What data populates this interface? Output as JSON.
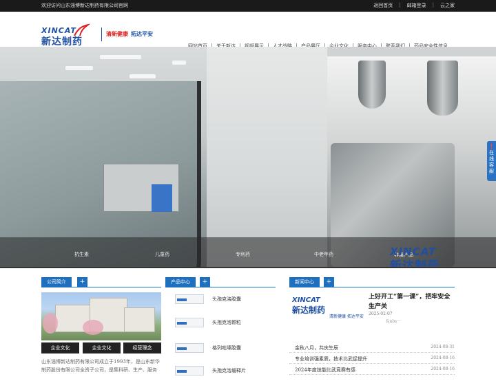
{
  "topbar": {
    "welcome": "欢迎访问山东淄博新达制药有限公司官网",
    "links": [
      "返回首页",
      "邮箱登录",
      "云之家"
    ]
  },
  "logo": {
    "en": "XINCAT",
    "cn": "新达制药"
  },
  "slogan": {
    "part1": "清新健康",
    "part2": "拓达平安"
  },
  "nav": [
    "网站首页",
    "关于新达",
    "视频展示",
    "人才战略",
    "产品展厅",
    "企业文化",
    "服务中心",
    "联系我们",
    "药品安全性信息"
  ],
  "hero": {
    "captions": [
      "抗生素",
      "儿童药",
      "专利药",
      "中老年药",
      "非甾产品"
    ],
    "watermark_en": "XINCAT",
    "watermark_cn": "新达制药"
  },
  "side_service": "在线客服",
  "company": {
    "tab": "公司简介",
    "plus": "+",
    "buttons": [
      "企业文化",
      "企业文化",
      "经营理念"
    ],
    "text": "山东淄博新达制药有限公司成立于1993年，是山东新华制药股份有限公司全资子公司，是集科研、生产、服务"
  },
  "products": {
    "tab": "产品中心",
    "plus": "+",
    "items": [
      "头孢克洛胶囊",
      "头孢克洛颗粒",
      "格列吡嗪胶囊",
      "头孢克洛缓释片"
    ]
  },
  "news": {
    "tab": "新闻中心",
    "plus": "+",
    "logo_en": "XINCAT",
    "logo_cn": "新达制药",
    "logo_tag": "清新健康 拓达平安",
    "featured_title": "上好开工“第一课”，把牢安全生产关",
    "featured_date": "2025-02-07",
    "featured_excerpt": "&nbs···",
    "items": [
      {
        "title": "金秋八月，共庆生辰",
        "date": "2024-08-31"
      },
      {
        "title": "专业培训强素质，技术比武促提升",
        "date": "2024-08-16"
      },
      {
        "title": "2024年度技能比武竞赛有感",
        "date": "2024-08-16"
      }
    ]
  },
  "colors": {
    "brand_blue": "#1f6fbf",
    "logo_blue": "#1f4fa5",
    "accent_red": "#e02020",
    "topbar": "#1a1a1a"
  }
}
